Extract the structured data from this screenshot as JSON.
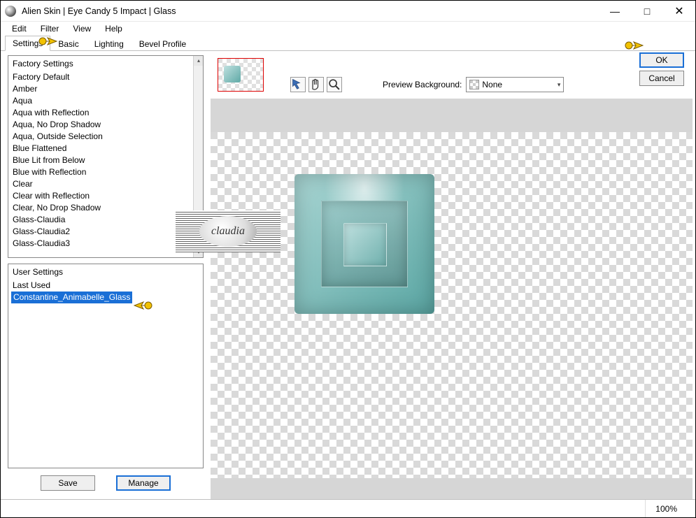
{
  "window": {
    "title": "Alien Skin | Eye Candy 5 Impact | Glass"
  },
  "menu": {
    "items": [
      "Edit",
      "Filter",
      "View",
      "Help"
    ]
  },
  "tabs": {
    "items": [
      "Settings",
      "Basic",
      "Lighting",
      "Bevel Profile"
    ],
    "active_index": 0
  },
  "factory": {
    "header": "Factory Settings",
    "items": [
      "Factory Default",
      "Amber",
      "Aqua",
      "Aqua with Reflection",
      "Aqua, No Drop Shadow",
      "Aqua, Outside Selection",
      "Blue Flattened",
      "Blue Lit from Below",
      "Blue with Reflection",
      "Clear",
      "Clear with Reflection",
      "Clear, No Drop Shadow",
      "Glass-Claudia",
      "Glass-Claudia2",
      "Glass-Claudia3"
    ]
  },
  "user": {
    "header": "User Settings",
    "items": [
      "Last Used",
      "Constantine_Animabelle_Glass"
    ],
    "selected_index": 1
  },
  "buttons": {
    "save": "Save",
    "manage": "Manage",
    "ok": "OK",
    "cancel": "Cancel"
  },
  "preview": {
    "bg_label": "Preview Background:",
    "bg_value": "None"
  },
  "status": {
    "zoom": "100%"
  },
  "watermark": {
    "text": "claudia"
  },
  "colors": {
    "accent": "#1a6fd6",
    "glass_teal": "#6fb0ad",
    "selection_highlight": "#1a6fd6",
    "thumb_border": "#d00"
  }
}
